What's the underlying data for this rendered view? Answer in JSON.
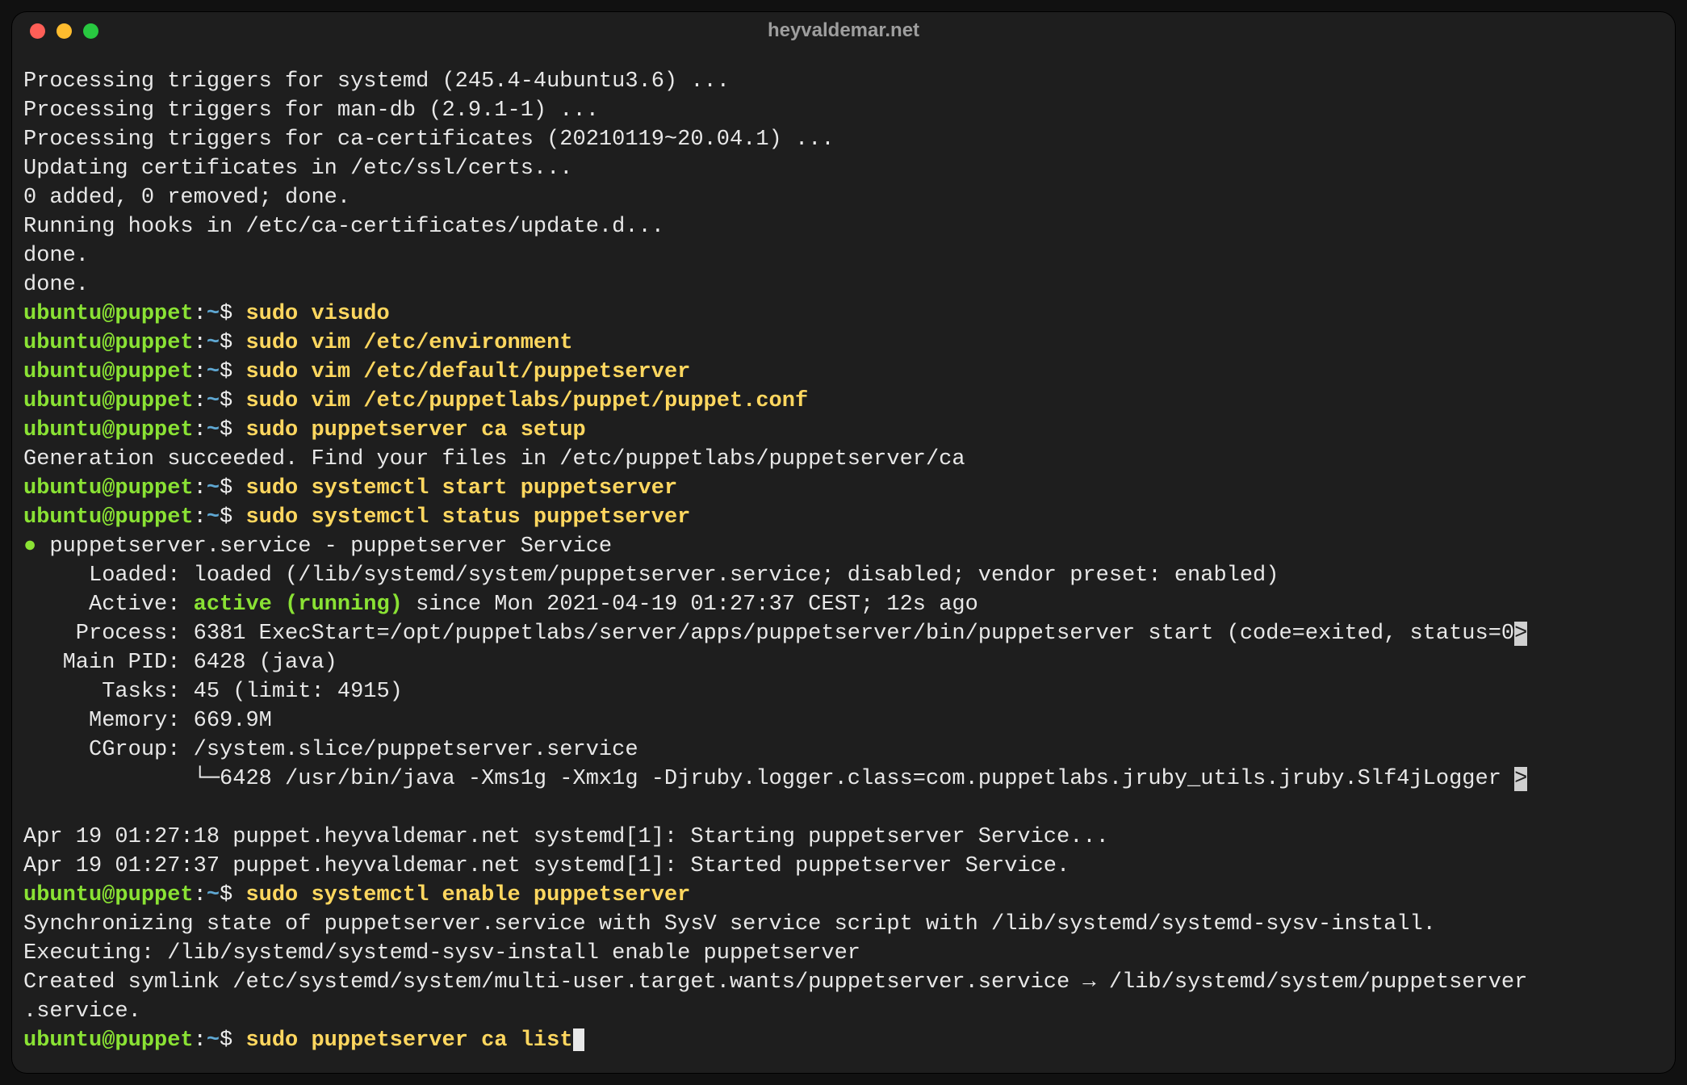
{
  "title": "heyvaldemar.net",
  "prompt": {
    "userhost": "ubuntu@puppet",
    "sep": ":",
    "path": "~",
    "sym": "$ "
  },
  "out": {
    "l1": "Processing triggers for systemd (245.4-4ubuntu3.6) ...",
    "l2": "Processing triggers for man-db (2.9.1-1) ...",
    "l3": "Processing triggers for ca-certificates (20210119~20.04.1) ...",
    "l4": "Updating certificates in /etc/ssl/certs...",
    "l5": "0 added, 0 removed; done.",
    "l6": "Running hooks in /etc/ca-certificates/update.d...",
    "l7": "",
    "l8": "done.",
    "l9": "done."
  },
  "cmd": {
    "c1": "sudo visudo",
    "c2": "sudo vim /etc/environment",
    "c3": "sudo vim /etc/default/puppetserver",
    "c4": "sudo vim /etc/puppetlabs/puppet/puppet.conf",
    "c5": "sudo puppetserver ca setup",
    "c6": "sudo systemctl start puppetserver",
    "c7": "sudo systemctl status puppetserver",
    "c8": "sudo systemctl enable puppetserver",
    "c9": "sudo puppetserver ca list"
  },
  "gen": "Generation succeeded. Find your files in /etc/puppetlabs/puppetserver/ca",
  "svc": {
    "bullet": "●",
    "head": " puppetserver.service - puppetserver Service",
    "loaded": "     Loaded: loaded (/lib/systemd/system/puppetserver.service; disabled; vendor preset: enabled)",
    "activeL": "     Active: ",
    "activeV": "active (running)",
    "activeR": " since Mon 2021-04-19 01:27:37 CEST; 12s ago",
    "proc": "    Process: 6381 ExecStart=/opt/puppetlabs/server/apps/puppetserver/bin/puppetserver start (code=exited, status=0",
    "pid": "   Main PID: 6428 (java)",
    "tasks": "      Tasks: 45 (limit: 4915)",
    "mem": "     Memory: 669.9M",
    "cgroup": "     CGroup: /system.slice/puppetserver.service",
    "tree": "             └─6428 /usr/bin/java -Xms1g -Xmx1g -Djruby.logger.class=com.puppetlabs.jruby_utils.jruby.Slf4jLogger ",
    "log1": "Apr 19 01:27:18 puppet.heyvaldemar.net systemd[1]: Starting puppetserver Service...",
    "log2": "Apr 19 01:27:37 puppet.heyvaldemar.net systemd[1]: Started puppetserver Service.",
    "gt": ">"
  },
  "en": {
    "l1": "Synchronizing state of puppetserver.service with SysV service script with /lib/systemd/systemd-sysv-install.",
    "l2": "Executing: /lib/systemd/systemd-sysv-install enable puppetserver",
    "l3": "Created symlink /etc/systemd/system/multi-user.target.wants/puppetserver.service → /lib/systemd/system/puppetserver",
    "l4": ".service."
  }
}
